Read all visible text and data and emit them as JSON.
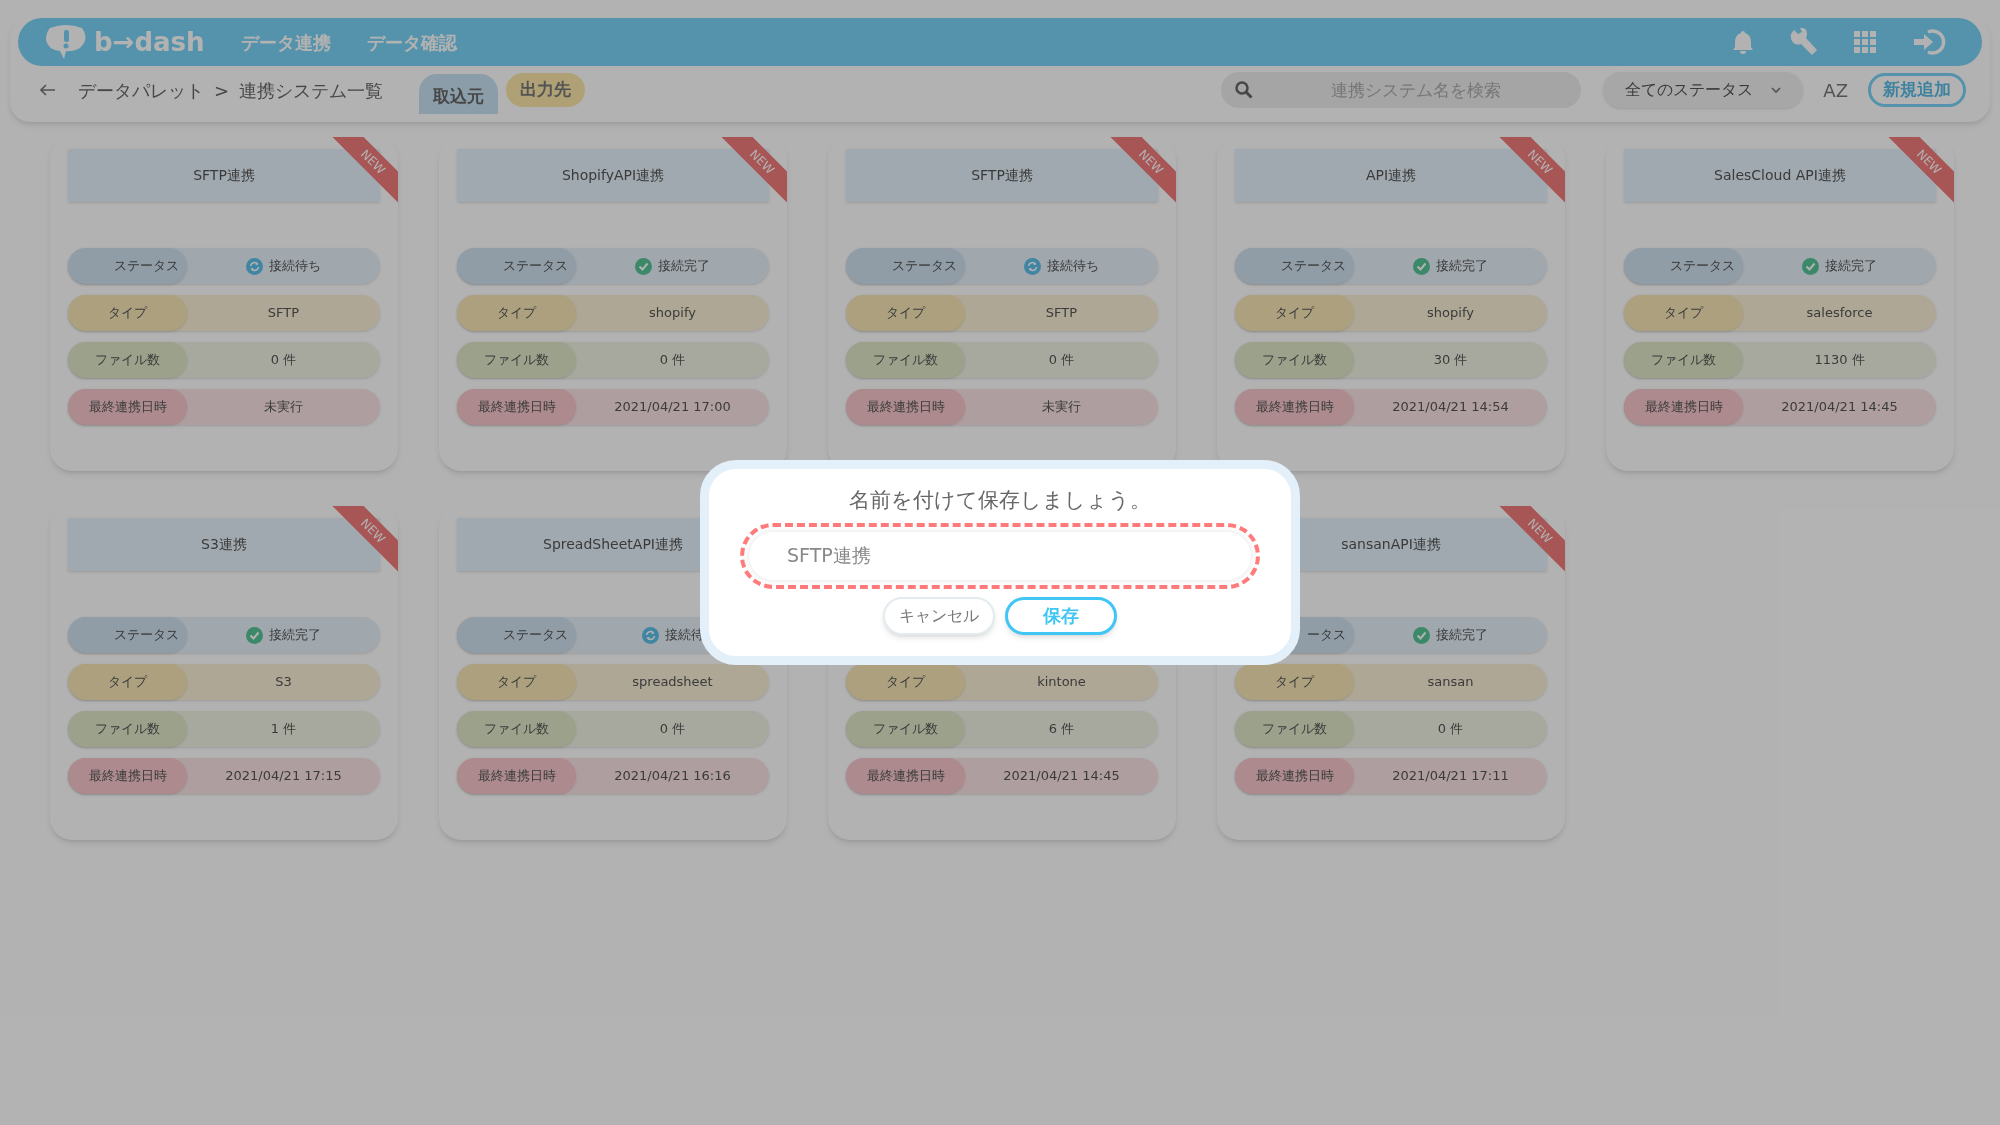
{
  "header": {
    "logo": "b→dash",
    "menu": [
      "データ連携",
      "データ確認"
    ]
  },
  "toolbar": {
    "breadcrumb": [
      "データパレット",
      "連携システム一覧"
    ],
    "separator": ">",
    "tabs": [
      {
        "label": "取込元",
        "selected": true
      },
      {
        "label": "出力先",
        "selected": false
      }
    ],
    "search": {
      "placeholder": "連携システム名を検索"
    },
    "status_filter": "全てのステータス",
    "sort": "AZ",
    "add_button": "新規追加"
  },
  "cards": [
    {
      "title": "SFTP連携",
      "badge": "NEW",
      "rows": [
        {
          "kind": "status",
          "label": "ステータス",
          "value": "接続待ち",
          "connected": false
        },
        {
          "kind": "type",
          "label": "タイプ",
          "value": "SFTP"
        },
        {
          "kind": "files",
          "label": "ファイル数",
          "value": "0 件"
        },
        {
          "kind": "last",
          "label": "最終連携日時",
          "value": "未実行"
        }
      ]
    },
    {
      "title": "ShopifyAPI連携",
      "badge": "NEW",
      "rows": [
        {
          "kind": "status",
          "label": "ステータス",
          "value": "接続完了",
          "connected": true
        },
        {
          "kind": "type",
          "label": "タイプ",
          "value": "shopify"
        },
        {
          "kind": "files",
          "label": "ファイル数",
          "value": "0 件"
        },
        {
          "kind": "last",
          "label": "最終連携日時",
          "value": "2021/04/21 17:00"
        }
      ]
    },
    {
      "title": "SFTP連携",
      "badge": "NEW",
      "rows": [
        {
          "kind": "status",
          "label": "ステータス",
          "value": "接続待ち",
          "connected": false
        },
        {
          "kind": "type",
          "label": "タイプ",
          "value": "SFTP"
        },
        {
          "kind": "files",
          "label": "ファイル数",
          "value": "0 件"
        },
        {
          "kind": "last",
          "label": "最終連携日時",
          "value": "未実行"
        }
      ]
    },
    {
      "title": "API連携",
      "badge": "NEW",
      "rows": [
        {
          "kind": "status",
          "label": "ステータス",
          "value": "接続完了",
          "connected": true
        },
        {
          "kind": "type",
          "label": "タイプ",
          "value": "shopify"
        },
        {
          "kind": "files",
          "label": "ファイル数",
          "value": "30 件"
        },
        {
          "kind": "last",
          "label": "最終連携日時",
          "value": "2021/04/21 14:54"
        }
      ]
    },
    {
      "title": "SalesCloud API連携",
      "badge": "NEW",
      "rows": [
        {
          "kind": "status",
          "label": "ステータス",
          "value": "接続完了",
          "connected": true
        },
        {
          "kind": "type",
          "label": "タイプ",
          "value": "salesforce"
        },
        {
          "kind": "files",
          "label": "ファイル数",
          "value": "1130 件"
        },
        {
          "kind": "last",
          "label": "最終連携日時",
          "value": "2021/04/21 14:45"
        }
      ]
    },
    {
      "title": "S3連携",
      "badge": "NEW",
      "rows": [
        {
          "kind": "status",
          "label": "ステータス",
          "value": "接続完了",
          "connected": true
        },
        {
          "kind": "type",
          "label": "タイプ",
          "value": "S3"
        },
        {
          "kind": "files",
          "label": "ファイル数",
          "value": "1 件"
        },
        {
          "kind": "last",
          "label": "最終連携日時",
          "value": "2021/04/21 17:15"
        }
      ]
    },
    {
      "title": "SpreadSheetAPI連携",
      "rows": [
        {
          "kind": "status",
          "label": "ステータス",
          "value": "接続待",
          "connected": false
        },
        {
          "kind": "type",
          "label": "タイプ",
          "value": "spreadsheet"
        },
        {
          "kind": "files",
          "label": "ファイル数",
          "value": "0 件"
        },
        {
          "kind": "last",
          "label": "最終連携日時",
          "value": "2021/04/21 16:16"
        }
      ]
    },
    {
      "rows": [
        {
          "kind": "type",
          "label": "タイプ",
          "value": "kintone"
        },
        {
          "kind": "files",
          "label": "ファイル数",
          "value": "6 件"
        },
        {
          "kind": "last",
          "label": "最終連携日時",
          "value": "2021/04/21 14:45"
        }
      ]
    },
    {
      "title": "sansanAPI連携",
      "badge": "NEW",
      "rows": [
        {
          "kind": "status",
          "label": "ータス",
          "value": "接続完了",
          "connected": true
        },
        {
          "kind": "type",
          "label": "タイプ",
          "value": "sansan"
        },
        {
          "kind": "files",
          "label": "ファイル数",
          "value": "0 件"
        },
        {
          "kind": "last",
          "label": "最終連携日時",
          "value": "2021/04/21 17:11"
        }
      ]
    }
  ],
  "dialog": {
    "message": "名前を付けて保存しましょう。",
    "input_value": "SFTP連携",
    "cancel": "キャンセル",
    "save": "保存"
  }
}
